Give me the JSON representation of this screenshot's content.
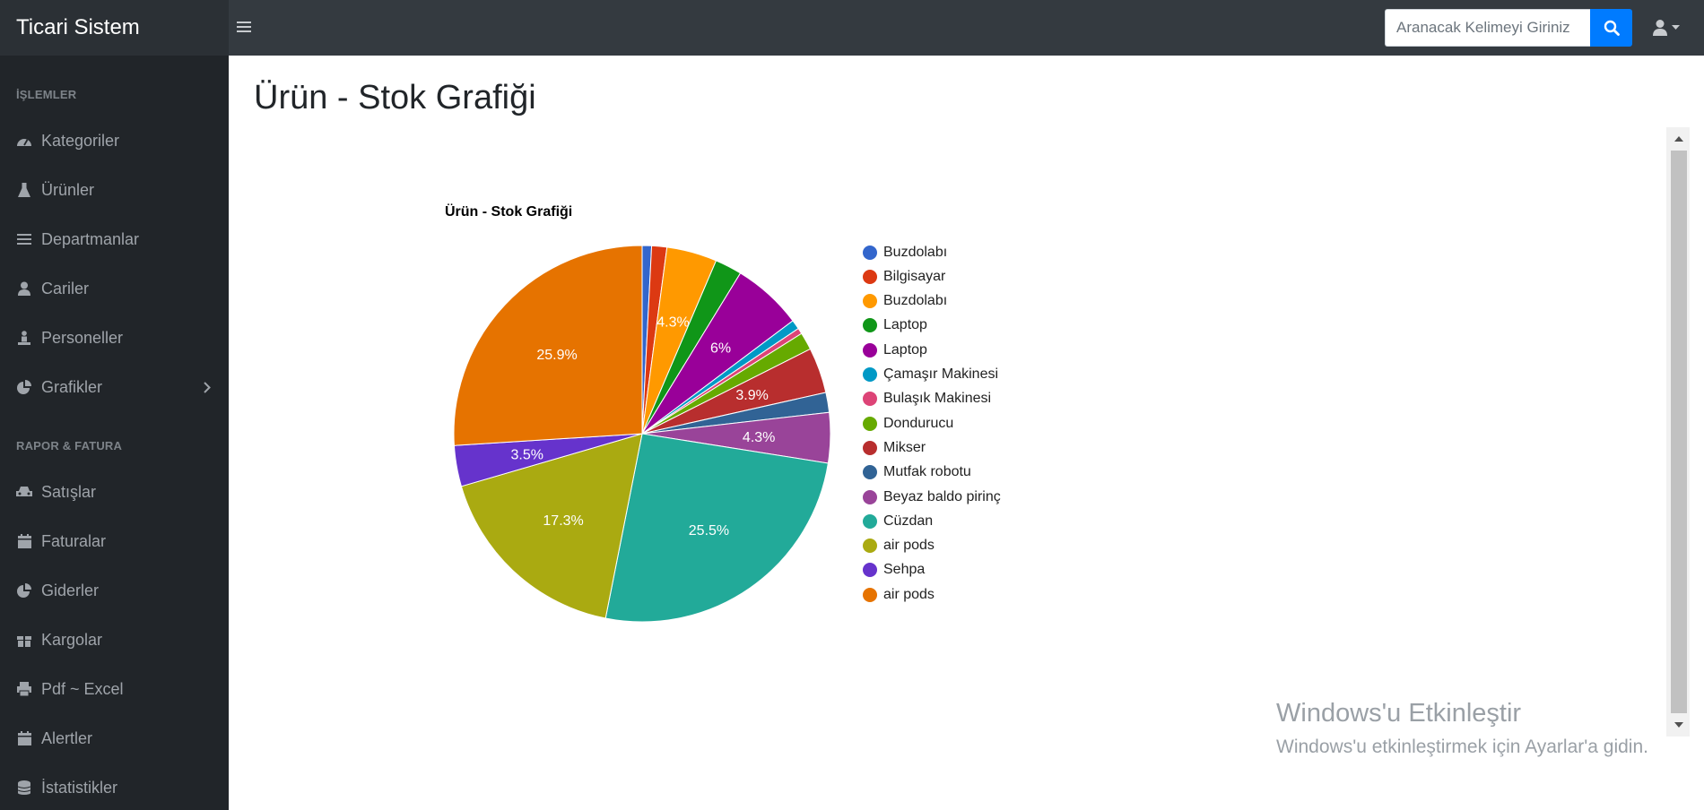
{
  "app": {
    "brand": "Ticari Sistem"
  },
  "search": {
    "placeholder": "Aranacak Kelimeyi Giriniz"
  },
  "sidebar": {
    "sections": [
      {
        "heading": "İŞLEMLER",
        "items": [
          {
            "label": "Kategoriler",
            "icon": "dashboard-icon"
          },
          {
            "label": "Ürünler",
            "icon": "flask-icon"
          },
          {
            "label": "Departmanlar",
            "icon": "list-icon"
          },
          {
            "label": "Cariler",
            "icon": "user-icon"
          },
          {
            "label": "Personeller",
            "icon": "male-user-icon"
          },
          {
            "label": "Grafikler",
            "icon": "pie-chart-icon"
          }
        ]
      },
      {
        "heading": "RAPOR & FATURA",
        "items": [
          {
            "label": "Satışlar",
            "icon": "car-icon"
          },
          {
            "label": "Faturalar",
            "icon": "calendar-icon"
          },
          {
            "label": "Giderler",
            "icon": "pie-chart-icon"
          },
          {
            "label": "Kargolar",
            "icon": "gift-icon"
          },
          {
            "label": "Pdf ~ Excel",
            "icon": "print-icon"
          },
          {
            "label": "Alertler",
            "icon": "calendar-icon"
          },
          {
            "label": "İstatistikler",
            "icon": "database-icon"
          }
        ]
      }
    ]
  },
  "page": {
    "title": "Ürün - Stok Grafiği"
  },
  "chart_data": {
    "type": "pie",
    "title": "Ürün - Stok Grafiği",
    "legend_position": "right",
    "slices": [
      {
        "label": "Buzdolabı",
        "percent": 0.8,
        "color": "#3366cc"
      },
      {
        "label": "Bilgisayar",
        "percent": 1.3,
        "color": "#dc3912"
      },
      {
        "label": "Buzdolabı",
        "percent": 4.3,
        "color": "#ff9900",
        "data_label": "4.3%"
      },
      {
        "label": "Laptop",
        "percent": 2.3,
        "color": "#109618"
      },
      {
        "label": "Laptop",
        "percent": 6.0,
        "color": "#990099",
        "data_label": "6%"
      },
      {
        "label": "Çamaşır Makinesi",
        "percent": 0.8,
        "color": "#0099c6"
      },
      {
        "label": "Bulaşık Makinesi",
        "percent": 0.5,
        "color": "#dd4477"
      },
      {
        "label": "Dondurucu",
        "percent": 1.5,
        "color": "#66aa00"
      },
      {
        "label": "Mikser",
        "percent": 3.9,
        "color": "#b82e2e",
        "data_label": "3.9%"
      },
      {
        "label": "Mutfak robotu",
        "percent": 1.7,
        "color": "#316395"
      },
      {
        "label": "Beyaz baldo pirinç",
        "percent": 4.3,
        "color": "#994499",
        "data_label": "4.3%"
      },
      {
        "label": "Cüzdan",
        "percent": 25.5,
        "color": "#22aa99",
        "data_label": "25.5%"
      },
      {
        "label": "air pods",
        "percent": 17.3,
        "color": "#aaaa11",
        "data_label": "17.3%"
      },
      {
        "label": "Sehpa",
        "percent": 3.5,
        "color": "#6633cc",
        "data_label": "3.5%"
      },
      {
        "label": "air pods",
        "percent": 25.9,
        "color": "#e67300",
        "data_label": "25.9%"
      }
    ]
  },
  "watermark": {
    "title": "Windows'u Etkinleştir",
    "subtitle": "Windows'u etkinleştirmek için Ayarlar'a gidin."
  }
}
